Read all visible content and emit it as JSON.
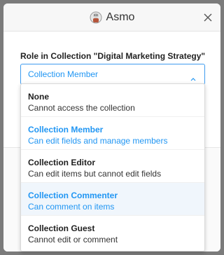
{
  "header": {
    "app_name": "Asmo",
    "logo_icon": "asmo-logo-icon",
    "close_icon": "close-icon"
  },
  "form": {
    "field_label": "Role in Collection \"Digital Marketing Strategy\"",
    "selected_value": "Collection Member"
  },
  "options": [
    {
      "title": "None",
      "description": "Cannot access the collection"
    },
    {
      "title": "Collection Member",
      "description": "Can edit fields and manage members"
    },
    {
      "title": "Collection Editor",
      "description": "Can edit items but cannot edit fields"
    },
    {
      "title": "Collection Commenter",
      "description": "Can comment on items"
    },
    {
      "title": "Collection Guest",
      "description": "Cannot edit or comment"
    }
  ],
  "colors": {
    "accent": "#2196f3",
    "hover_bg": "#f0f6fc",
    "overlay": "#7b7b7b"
  }
}
